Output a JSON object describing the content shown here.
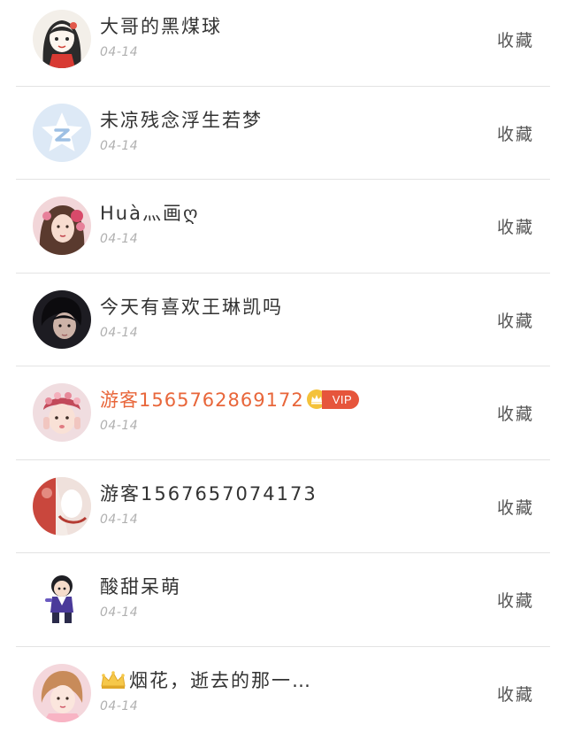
{
  "favorite_label": "收藏",
  "users": [
    {
      "name": "大哥的黑煤球",
      "date": "04-14",
      "avatar": "avatar-cartoon-girl"
    },
    {
      "name": "未凉残念浮生若梦",
      "date": "04-14",
      "avatar": "avatar-default-star"
    },
    {
      "name": "Huà灬画ღ",
      "date": "04-14",
      "avatar": "avatar-flower-girl"
    },
    {
      "name": "今天有喜欢王琳凯吗",
      "date": "04-14",
      "avatar": "avatar-dark-portrait"
    },
    {
      "name": "游客1565762869172",
      "date": "04-14",
      "avatar": "avatar-child-pink",
      "vip": true,
      "vip_label": "VIP"
    },
    {
      "name": "游客1567657074173",
      "date": "04-14",
      "avatar": "avatar-red-white"
    },
    {
      "name": "酸甜呆萌",
      "date": "04-14",
      "avatar": "avatar-chibi-boy"
    },
    {
      "name": "烟花，逝去的那一…",
      "date": "04-14",
      "avatar": "avatar-pink-girl",
      "crown_prefix": true
    }
  ],
  "colors": {
    "vip_name": "#e8663a",
    "vip_tag": "#e6553c",
    "name": "#333333",
    "date": "#b0b0b0",
    "divider": "#e3e3e3"
  }
}
